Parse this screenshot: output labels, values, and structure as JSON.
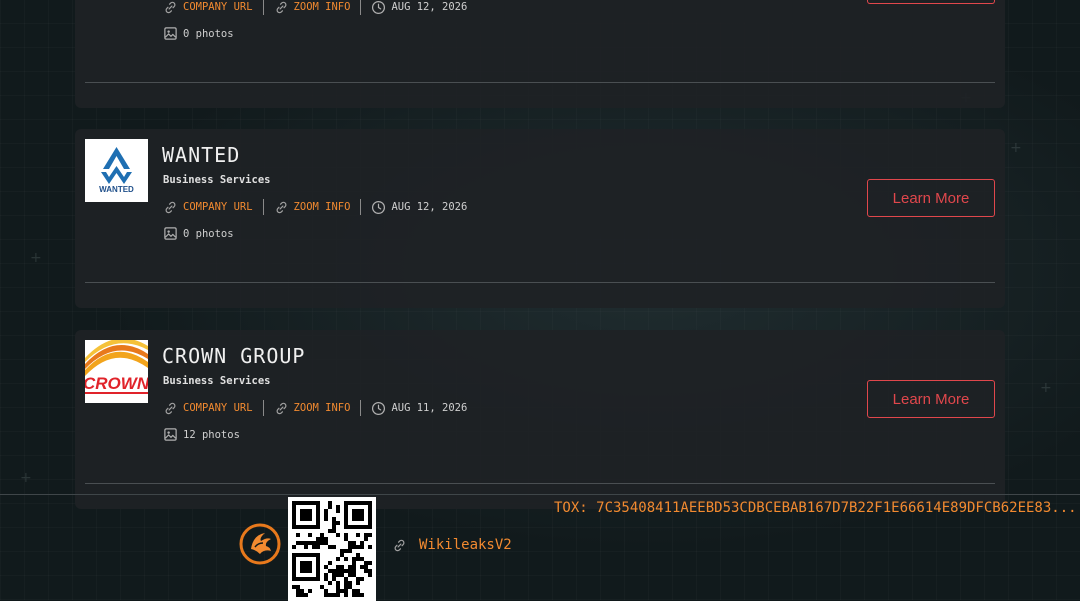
{
  "listings": [
    {
      "title": "",
      "category": "",
      "company_url_label": "COMPANY URL",
      "zoom_info_label": "ZOOM INFO",
      "date": "AUG 12, 2026",
      "photos": "0 photos",
      "button_label": ""
    },
    {
      "title": "WANTED",
      "category": "Business Services",
      "company_url_label": "COMPANY URL",
      "zoom_info_label": "ZOOM INFO",
      "date": "AUG 12, 2026",
      "photos": "0 photos",
      "button_label": "Learn More",
      "logo_text": "WANTED"
    },
    {
      "title": "CROWN GROUP",
      "category": "Business Services",
      "company_url_label": "COMPANY URL",
      "zoom_info_label": "ZOOM INFO",
      "date": "AUG 11, 2026",
      "photos": "12 photos",
      "button_label": "Learn More",
      "logo_text": "CROWN"
    }
  ],
  "footer": {
    "link_label": "WikileaksV2",
    "tox": "TOX: 7C35408411AEEBD53CDBCEBAB167D7B22F1E66614E89DFCB62EE83..."
  },
  "colors": {
    "accent_orange": "#f28a30",
    "button_red": "#e0474c",
    "card_bg": "#1e2225"
  },
  "icons": [
    "link-icon",
    "clock-icon",
    "image-icon",
    "phoenix-logo",
    "qr-code"
  ]
}
